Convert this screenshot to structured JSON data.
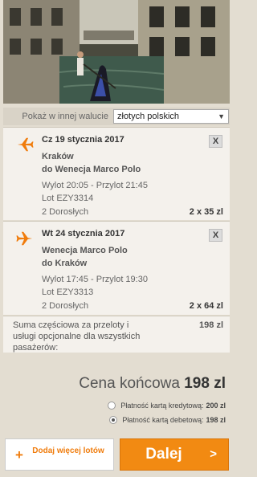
{
  "photo": {
    "alt_name": "venice-gondola-photo"
  },
  "currency": {
    "label": "Pokaż w innej walucie",
    "selected": "złotych polskich"
  },
  "flights": [
    {
      "date": "Cz 19 stycznia 2017",
      "from": "Kraków",
      "to": "do Wenecja Marco Polo",
      "times": "Wylot 20:05 - Przylot 21:45",
      "flight_no": "Lot EZY3314",
      "passengers": "2 Dorosłych",
      "price": "2 x 35 zl",
      "close": "X"
    },
    {
      "date": "Wt 24 stycznia 2017",
      "from": "Wenecja Marco Polo",
      "to": "do Kraków",
      "times": "Wylot 17:45 - Przylot 19:30",
      "flight_no": "Lot EZY3313",
      "passengers": "2 Dorosłych",
      "price": "2 x 64 zl",
      "close": "X"
    }
  ],
  "summary": {
    "text": "Suma częściowa za przeloty i usługi opcjonalne dla wszystkich pasażerów:",
    "amount": "198 zl"
  },
  "total": {
    "label": "Cena końcowa",
    "amount": "198 zl"
  },
  "payment": [
    {
      "label": "Płatność kartą kredytową:",
      "amount": "200 zl",
      "selected": false
    },
    {
      "label": "Płatność kartą debetową:",
      "amount": "198 zl",
      "selected": true
    }
  ],
  "buttons": {
    "add_plus": "+",
    "add_label": "Dodaj więcej lotów",
    "next_label": "Dalej",
    "next_arrow": ">"
  },
  "colors": {
    "accent": "#f28a12",
    "background": "#e3ddd1",
    "card": "#f4f1ec"
  }
}
